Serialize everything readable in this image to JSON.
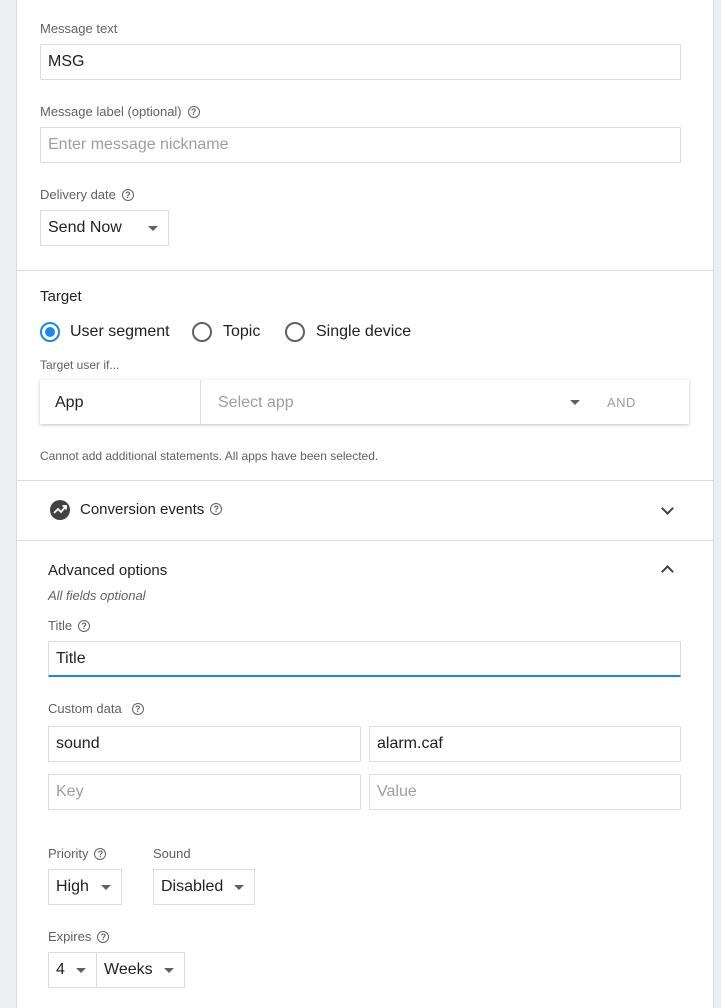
{
  "message": {
    "text_label": "Message text",
    "text_value": "MSG",
    "label_label": "Message label (optional)",
    "label_placeholder": "Enter message nickname",
    "delivery_label": "Delivery date",
    "delivery_value": "Send Now"
  },
  "target": {
    "heading": "Target",
    "options": [
      "User segment",
      "Topic",
      "Single device"
    ],
    "selected": "User segment",
    "condition_label": "Target user if...",
    "row_app": "App",
    "row_select_placeholder": "Select app",
    "row_and": "AND",
    "note": "Cannot add additional statements. All apps have been selected."
  },
  "conversion": {
    "heading": "Conversion events"
  },
  "advanced": {
    "heading": "Advanced options",
    "subtitle": "All fields optional",
    "title_label": "Title",
    "title_value": "Title",
    "custom_label": "Custom data",
    "custom_rows": [
      {
        "key": "sound",
        "value": "alarm.caf"
      }
    ],
    "key_placeholder": "Key",
    "value_placeholder": "Value",
    "priority_label": "Priority",
    "priority_value": "High",
    "sound_label": "Sound",
    "sound_value": "Disabled",
    "expires_label": "Expires",
    "expires_number": "4",
    "expires_unit": "Weeks"
  },
  "icons": {
    "help": "?",
    "conversion": "trending-up-icon"
  },
  "colors": {
    "accent": "#1e88e5",
    "active_underline": "#1e88c9",
    "divider": "#dadce0"
  }
}
